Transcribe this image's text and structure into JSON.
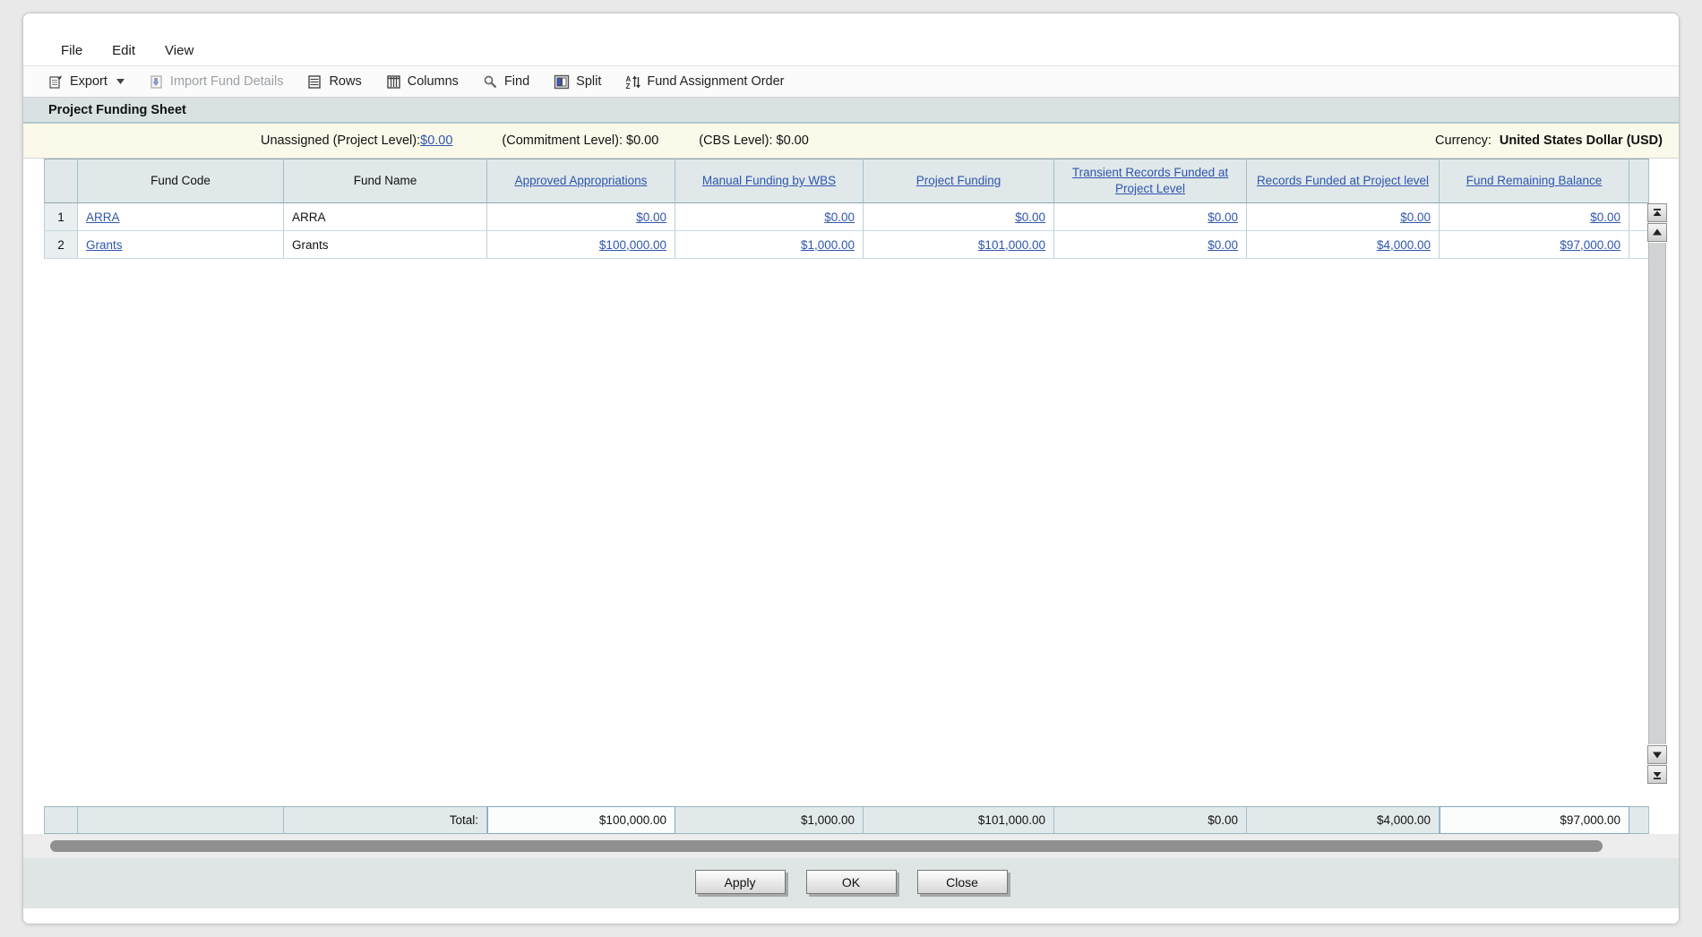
{
  "menu": {
    "items": [
      "File",
      "Edit",
      "View"
    ]
  },
  "toolbar": {
    "items": [
      {
        "label": "Export"
      },
      {
        "label": "Import Fund Details"
      },
      {
        "label": "Rows"
      },
      {
        "label": "Columns"
      },
      {
        "label": "Find"
      },
      {
        "label": "Split"
      },
      {
        "label": "Fund Assignment Order"
      }
    ]
  },
  "header": {
    "title": "Project Funding Sheet"
  },
  "info_bar": {
    "unassigned_label": "Unassigned (Project Level):",
    "unassigned_value": "$0.00",
    "commitment_text": "(Commitment Level): $0.00",
    "cbs_text": "(CBS Level): $0.00",
    "currency_label": "Currency:",
    "currency_value": "United States Dollar (USD)"
  },
  "table": {
    "columns": [
      "Fund Code",
      "Fund Name",
      "Approved Appropriations",
      "Manual Funding by WBS",
      "Project Funding",
      "Transient Records Funded at Project Level",
      "Records Funded at Project level",
      "Fund Remaining Balance"
    ],
    "rows": [
      {
        "num": "1",
        "fund_code": "ARRA",
        "fund_name": "ARRA",
        "values": [
          "$0.00",
          "$0.00",
          "$0.00",
          "$0.00",
          "$0.00",
          "$0.00"
        ]
      },
      {
        "num": "2",
        "fund_code": "Grants",
        "fund_name": "Grants",
        "values": [
          "$100,000.00",
          "$1,000.00",
          "$101,000.00",
          "$0.00",
          "$4,000.00",
          "$97,000.00"
        ]
      }
    ],
    "total_label": "Total:",
    "totals": [
      "$100,000.00",
      "$1,000.00",
      "$101,000.00",
      "$0.00",
      "$4,000.00",
      "$97,000.00"
    ]
  },
  "footer": {
    "buttons": [
      "Apply",
      "OK",
      "Close"
    ]
  },
  "colors": {
    "link_blue": "#2f56ae",
    "header_bg": "#e0e8ea",
    "title_bar_bg": "#d9e1e3",
    "info_bar_bg": "#fbf9ea"
  }
}
